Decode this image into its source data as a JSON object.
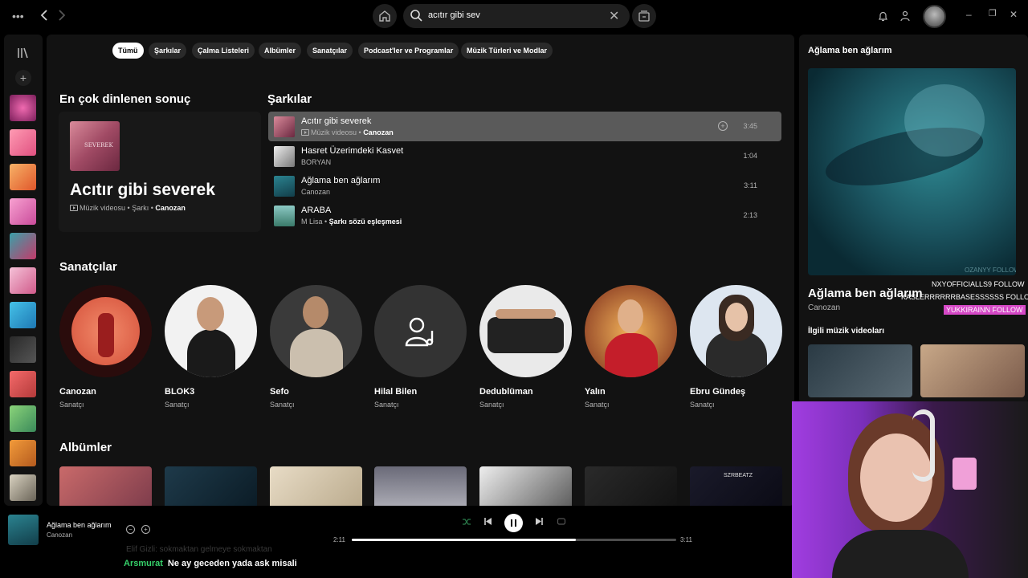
{
  "search": {
    "value": "acıtır gibi sev"
  },
  "filters": [
    "Tümü",
    "Şarkılar",
    "Çalma Listeleri",
    "Albümler",
    "Sanatçılar",
    "Podcast'ler ve Programlar",
    "Müzik Türleri ve Modlar"
  ],
  "top_result": {
    "heading": "En çok dinlenen sonuç",
    "cover_text": "SEVEREK",
    "name": "Acıtır gibi severek",
    "type": "Müzik videosu",
    "kind": "Şarkı",
    "artist": "Canozan"
  },
  "songs": {
    "heading": "Şarkılar",
    "items": [
      {
        "title": "Acıtır gibi severek",
        "sub": "Müzik videosu",
        "artist": "Canozan",
        "duration": "3:45"
      },
      {
        "title": "Hasret Üzerimdeki Kasvet",
        "sub": "",
        "artist": "BORYAN",
        "duration": "1:04"
      },
      {
        "title": "Ağlama ben ağlarım",
        "sub": "",
        "artist": "Canozan",
        "duration": "3:11"
      },
      {
        "title": "ARABA",
        "sub": "M Lisa",
        "artist": "Şarkı sözü eşleşmesi",
        "duration": "2:13"
      }
    ]
  },
  "artists": {
    "heading": "Sanatçılar",
    "items": [
      {
        "name": "Canozan",
        "role": "Sanatçı"
      },
      {
        "name": "BLOK3",
        "role": "Sanatçı"
      },
      {
        "name": "Sefo",
        "role": "Sanatçı"
      },
      {
        "name": "Hilal Bilen",
        "role": "Sanatçı"
      },
      {
        "name": "Dedublüman",
        "role": "Sanatçı"
      },
      {
        "name": "Yalın",
        "role": "Sanatçı"
      },
      {
        "name": "Ebru Gündeş",
        "role": "Sanatçı"
      }
    ]
  },
  "albums": {
    "heading": "Albümler",
    "szr_label": "SZRBEATZ"
  },
  "now_playing_panel": {
    "heading": "Ağlama ben ağlarım",
    "title": "Ağlama ben ağlarım",
    "artist": "Canozan",
    "related": "İlgili müzik videoları",
    "overlay_follows": [
      "OZANYY FOLLOW",
      "NXYOFFICIALLS9  FOLLOW",
      "KASLERRRRRRBASESSSSSS  FOLLOW",
      "YUKKIRAINN  FOLLOW"
    ]
  },
  "player": {
    "title": "Ağlama ben ağlarım",
    "artist": "Canozan",
    "elapsed": "2:11",
    "total": "3:11",
    "progress": 0.69
  },
  "chat": {
    "ghost": "Elif Gizli:  sokmaktan gelmeye sokmaktan",
    "user": "Arsmurat",
    "message": "Ne ay geceden yada ask misali"
  },
  "colors": {
    "accent_green": "#1ed760",
    "highlight_row": "#5a5a5a",
    "follow_pink": "#d548c6",
    "chat_user": "#36d16a"
  }
}
